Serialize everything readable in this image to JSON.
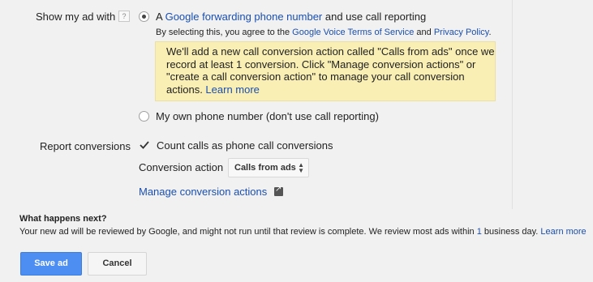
{
  "show_ad": {
    "label": "Show my ad with",
    "help": "?",
    "option1": {
      "prefix": "A ",
      "link": "Google forwarding phone number",
      "suffix": " and use call reporting",
      "selected": true
    },
    "agreement": {
      "prefix": "By selecting this, you agree to the ",
      "tos_link": "Google Voice Terms of Service",
      "and": " and ",
      "privacy_link": "Privacy Policy",
      "suffix": "."
    },
    "note": {
      "text": "We'll add a new call conversion action called \"Calls from ads\" once we record at least 1 conversion. Click \"Manage conversion actions\" or \"create a call conversion action\" to manage your call conversion actions. ",
      "link": "Learn more"
    },
    "option2": {
      "label": "My own phone number (don't use call reporting)",
      "selected": false
    }
  },
  "report": {
    "label": "Report conversions",
    "checkbox_label": "Count calls as phone call conversions",
    "checked": true,
    "conversion_action_label": "Conversion action",
    "conversion_action_value": "Calls from ads",
    "manage_link": "Manage conversion actions"
  },
  "next": {
    "title": "What happens next?",
    "body_prefix": "Your new ad will be reviewed by Google, and might not run until that review is complete. We review most ads within ",
    "body_number": "1",
    "body_suffix": " business day. ",
    "link": "Learn more"
  },
  "buttons": {
    "save": "Save ad",
    "cancel": "Cancel"
  }
}
